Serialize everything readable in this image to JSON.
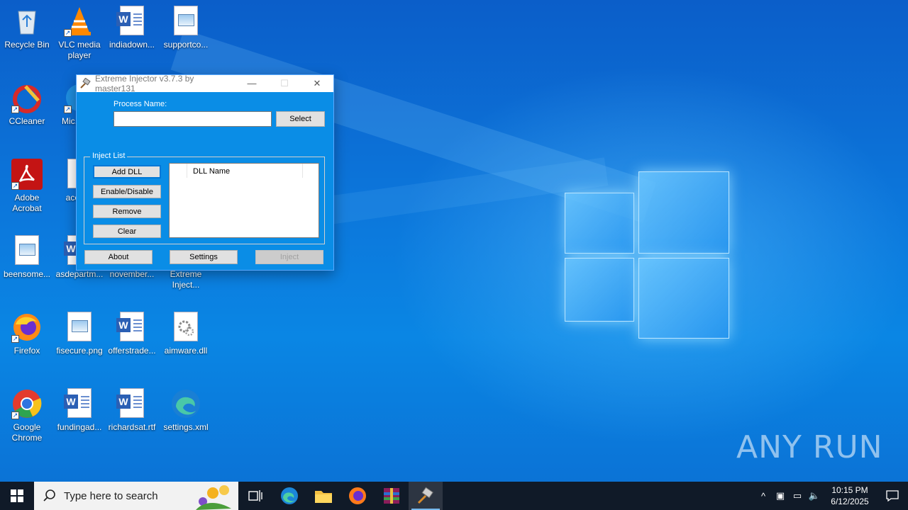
{
  "desktop": {
    "icons": [
      {
        "label": "Recycle Bin"
      },
      {
        "label": "VLC media player"
      },
      {
        "label": "indiadown..."
      },
      {
        "label": "supportco..."
      },
      {
        "label": "CCleaner"
      },
      {
        "label": "Mic... E..."
      },
      {
        "label": "Adobe Acrobat"
      },
      {
        "label": "accor..."
      },
      {
        "label": "beensome..."
      },
      {
        "label": "asdepartm..."
      },
      {
        "label": "november..."
      },
      {
        "label": "Extreme Inject..."
      },
      {
        "label": "Firefox"
      },
      {
        "label": "fisecure.png"
      },
      {
        "label": "offerstrade..."
      },
      {
        "label": "aimware.dll"
      },
      {
        "label": "Google Chrome"
      },
      {
        "label": "fundingad..."
      },
      {
        "label": "richardsat.rtf"
      },
      {
        "label": "settings.xml"
      }
    ]
  },
  "injector": {
    "title": "Extreme Injector v3.7.3 by master131",
    "process_label": "Process Name:",
    "process_value": "",
    "select_button": "Select",
    "inject_list_label": "Inject List",
    "add_dll_button": "Add DLL",
    "enable_disable_button": "Enable/Disable",
    "remove_button": "Remove",
    "clear_button": "Clear",
    "dll_column_header": "DLL Name",
    "about_button": "About",
    "settings_button": "Settings",
    "inject_button": "Inject"
  },
  "taskbar": {
    "search_placeholder": "Type here to search",
    "time": "10:15 PM",
    "date": "6/12/2025"
  },
  "watermark": "ANY RUN",
  "colors": {
    "desktop_blue": "#0a6fd6",
    "window_body": "#0a8de6",
    "taskbar": "#101a28"
  }
}
